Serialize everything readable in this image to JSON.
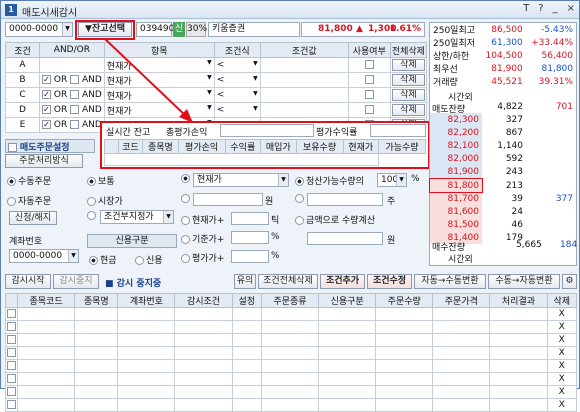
{
  "window": {
    "title": "매도시세감시",
    "icon": "1",
    "buttons": [
      "T",
      "?",
      "_",
      "×"
    ]
  },
  "toolbar": {
    "account": "0000-0000",
    "remain_btn": "▼잔고선택",
    "code": "039490",
    "tag1": "신",
    "tag2": "30%",
    "name": "키움증권",
    "price": "81,800",
    "change_arrow": "▲",
    "change": "1,300",
    "rate": "1.61%"
  },
  "cond_table": {
    "headers": [
      "조건",
      "AND/OR",
      "항목",
      "조건식",
      "조건값",
      "사용여부",
      "전체삭제"
    ],
    "rows": [
      {
        "id": "A",
        "andor": "",
        "item": "현재가",
        "op": "<",
        "del": "삭제",
        "checked": false
      },
      {
        "id": "B",
        "andor": "OR",
        "item": "현재가",
        "op": "<",
        "del": "삭제",
        "checked": true
      },
      {
        "id": "C",
        "andor": "OR",
        "item": "현재가",
        "op": "<",
        "del": "삭제",
        "checked": true
      },
      {
        "id": "D",
        "andor": "OR",
        "item": "현재가",
        "op": "<",
        "del": "삭제",
        "checked": true
      },
      {
        "id": "E",
        "andor": "OR",
        "item": "현재가",
        "op": "<",
        "del": "삭제",
        "checked": true
      }
    ],
    "and_label": "AND"
  },
  "popup": {
    "items": [
      "실시간 잔고",
      "총평가손익",
      "평가수익률"
    ],
    "headers": [
      "코드",
      "종목명",
      "평가손익",
      "수익률",
      "매입가",
      "보유수량",
      "현재가",
      "가능수량"
    ]
  },
  "quote_top": [
    {
      "label": "250일최고",
      "v1": "86,500",
      "v2": "-5.43%"
    },
    {
      "label": "250일최저",
      "v1": "61,300",
      "v2": "+33.44%"
    },
    {
      "label": "상한/하한",
      "v1": "104,500",
      "v2": "56,400"
    },
    {
      "label": "최우선",
      "v1": "81,900",
      "v2": "81,800"
    },
    {
      "label": "거래량",
      "v1": "45,521",
      "v2": "39.31%"
    }
  ],
  "quote_labels": {
    "outside": "시간외",
    "sell_rem": "매도잔량",
    "buy_rem": "매수잔량",
    "outside2": "시간외"
  },
  "sell_asks": [
    {
      "p": "",
      "q": "4,822",
      "x": "701"
    },
    {
      "p": "82,300",
      "q": "327",
      "x": ""
    },
    {
      "p": "82,200",
      "q": "867",
      "x": ""
    },
    {
      "p": "82,100",
      "q": "1,140",
      "x": ""
    },
    {
      "p": "82,000",
      "q": "592",
      "x": ""
    },
    {
      "p": "81,900",
      "q": "243",
      "x": ""
    }
  ],
  "buy_bids": [
    {
      "p": "81,800",
      "q": "213",
      "x": ""
    },
    {
      "p": "81,700",
      "q": "39",
      "x": "377"
    },
    {
      "p": "81,600",
      "q": "24",
      "x": ""
    },
    {
      "p": "81,500",
      "q": "46",
      "x": ""
    },
    {
      "p": "81,400",
      "q": "179",
      "x": ""
    }
  ],
  "totals": {
    "buy_rem_val": "5,665",
    "buy_rem_x": "184"
  },
  "order": {
    "title": "매도주문설정",
    "method_btn": "주문처리방식",
    "auto": "수동주문",
    "auto2": "자동주문",
    "signal": "신청/해지",
    "normal": "보통",
    "market": "시장가",
    "cond_limit": "조건부지정가",
    "price_sel": "현재가",
    "cur_plus": "현재가+",
    "base_plus": "기준가+",
    "eval_plus": "평가가+",
    "tick": "틱",
    "won": "원",
    "pct": "%",
    "clear_qty": "청산가능수량의",
    "qty_pct": "100",
    "pct2": "%",
    "ju": "주",
    "amount": "금액으로 수량계산",
    "won2": "원",
    "account_label": "계좌번호",
    "account": "0000-0000",
    "credit_label": "신용구분",
    "cash": "현금",
    "credit": "신용"
  },
  "watch": {
    "start": "감시시작",
    "stop": "감시중지",
    "status": "■ 감시 중지중",
    "b1": "유의",
    "b2": "조건전체삭제",
    "b3": "조건추가",
    "b4": "조건수정",
    "b5": "자동→수동변환",
    "b6": "수동→자동변환"
  },
  "grid": {
    "headers": [
      "종목코드",
      "종목명",
      "계좌번호",
      "감시조건",
      "설정",
      "주문종류",
      "신용구분",
      "주문수량",
      "주문가격",
      "처리결과",
      "삭제"
    ],
    "rows": 8,
    "del": "X"
  },
  "colors": {
    "accent": "#e0101b",
    "blue": "#1a52c8"
  }
}
